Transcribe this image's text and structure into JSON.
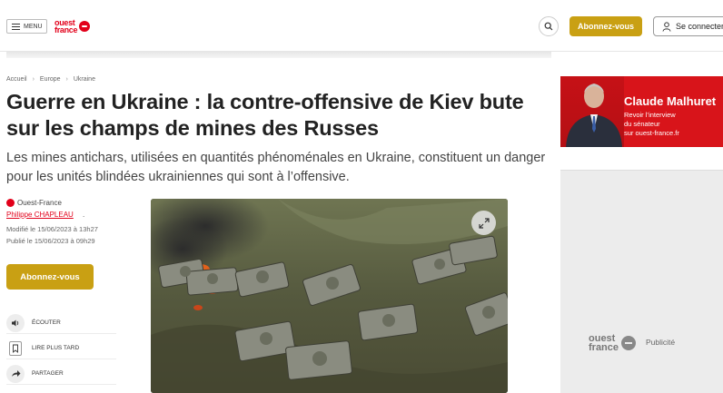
{
  "header": {
    "menu_label": "MENU",
    "logo_text_line1": "ouest",
    "logo_text_line2": "france",
    "subscribe_label": "Abonnez-vous",
    "connect_label": "Se connecter"
  },
  "breadcrumb": [
    "Accueil",
    "Europe",
    "Ukraine"
  ],
  "article": {
    "title": "Guerre en Ukraine : la contre-offensive de Kiev bute sur les champs de mines des Russes",
    "subtitle": "Les mines antichars, utilisées en quantités phénoménales en Ukraine, constituent un danger pour les unités blindées ukrainiennes qui sont à l’offensive.",
    "source": "Ouest-France",
    "author": "Philippe CHAPLEAU",
    "author_suffix": ".",
    "modified": "Modifié le 15/06/2023 à 13h27",
    "published": "Publié le 15/06/2023 à 09h29",
    "subscribe_label": "Abonnez-vous"
  },
  "actions": [
    {
      "label": "ÉCOUTER",
      "icon": "speaker-icon"
    },
    {
      "label": "LIRE PLUS TARD",
      "icon": "bookmark-icon"
    },
    {
      "label": "PARTAGER",
      "icon": "share-icon"
    }
  ],
  "sidebar": {
    "ad_name": "Claude Malhuret",
    "ad_line1": "Revoir l’interview",
    "ad_line2": "du sénateur",
    "ad_line3": "sur ouest-france.fr",
    "pub_logo_line1": "ouest",
    "pub_logo_line2": "france",
    "pub_label": "Publicité"
  },
  "colors": {
    "brand_red": "#e2001a",
    "subscribe_gold": "#c9a013"
  }
}
